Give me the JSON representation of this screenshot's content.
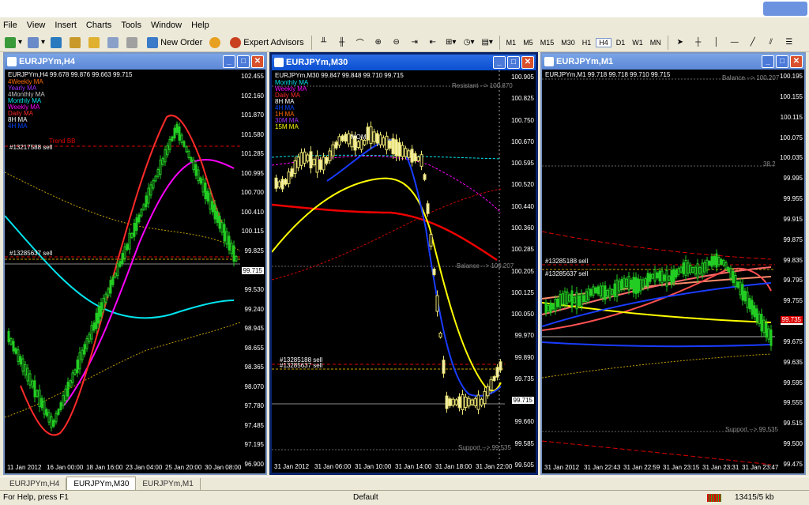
{
  "menu": [
    "File",
    "View",
    "Insert",
    "Charts",
    "Tools",
    "Window",
    "Help"
  ],
  "toolbar": {
    "new_order": "New Order",
    "expert_advisors": "Expert Advisors",
    "timeframes": [
      "M1",
      "M5",
      "M15",
      "M30",
      "H1",
      "H4",
      "D1",
      "W1",
      "MN"
    ],
    "active_timeframe": "H4"
  },
  "panels": [
    {
      "title": "EURJPYm,H4",
      "header": "EURJPYm,H4  99.678 99.876 99.663 99.715",
      "legend": [
        {
          "text": "4Weekly MA",
          "color": "#ff6a00"
        },
        {
          "text": "Yearly MA",
          "color": "#9b30ff"
        },
        {
          "text": "4Monthly MA",
          "color": "#c8c8c8"
        },
        {
          "text": "Monthly MA",
          "color": "#00e5ee"
        },
        {
          "text": "Weekly MA",
          "color": "#ff00ff"
        },
        {
          "text": "Daily MA",
          "color": "#ff2a2a"
        },
        {
          "text": "8H MA",
          "color": "#ffffff"
        },
        {
          "text": "4H MA",
          "color": "#0044ff"
        }
      ],
      "labels": [
        "#13217588 sell",
        "#13285637 sell",
        "Trend BB"
      ],
      "prices": [
        "102.455",
        "102.160",
        "101.870",
        "101.580",
        "101.285",
        "100.995",
        "100.700",
        "100.410",
        "100.115",
        "99.825",
        "99.715",
        "99.530",
        "99.240",
        "98.945",
        "98.655",
        "98.365",
        "98.070",
        "97.780",
        "97.485",
        "97.195",
        "96.900"
      ],
      "current": "99.715",
      "dates": [
        "11 Jan 2012",
        "16 Jan 00:00",
        "18 Jan 16:00",
        "23 Jan 04:00",
        "25 Jan 20:00",
        "30 Jan 08:00"
      ]
    },
    {
      "title": "EURJPYm,M30",
      "header": "EURJPYm,M30  99.847 99.848 99.710 99.715",
      "legend": [
        {
          "text": "Monthly MA",
          "color": "#00e5ee"
        },
        {
          "text": "Weekly MA",
          "color": "#ff00ff"
        },
        {
          "text": "Daily MA",
          "color": "#ff2a2a"
        },
        {
          "text": "8H MA",
          "color": "#ffffff"
        },
        {
          "text": "4H MA",
          "color": "#0044ff"
        },
        {
          "text": "1H MA",
          "color": "#ff6a00"
        },
        {
          "text": "30M MA",
          "color": "#9b30ff"
        },
        {
          "text": "15M MA",
          "color": "#ffff00"
        }
      ],
      "labels": [
        "Resistant --> 100.870",
        "MOM",
        "Balance --> 100.207",
        "#13285188 sell",
        "#13285637 sell",
        "Support --> 99.535"
      ],
      "prices": [
        "100.905",
        "100.825",
        "100.750",
        "100.670",
        "100.595",
        "100.520",
        "100.440",
        "100.360",
        "100.285",
        "100.205",
        "100.125",
        "100.050",
        "99.970",
        "99.890",
        "99.735",
        "99.715",
        "99.660",
        "99.585",
        "99.505"
      ],
      "current": "99.715",
      "dates": [
        "31 Jan 2012",
        "31 Jan 06:00",
        "31 Jan 10:00",
        "31 Jan 14:00",
        "31 Jan 18:00",
        "31 Jan 22:00"
      ]
    },
    {
      "title": "EURJPYm,M1",
      "header": "EURJPYm,M1  99.718 99.718 99.710 99.715",
      "labels": [
        "Balance --> 100.207",
        "38.2",
        "#13285188 sell",
        "#13285637 sell",
        "Support --> 99.535"
      ],
      "prices": [
        "100.195",
        "100.155",
        "100.115",
        "100.075",
        "100.035",
        "99.995",
        "99.955",
        "99.915",
        "99.875",
        "99.835",
        "99.795",
        "99.755",
        "99.715",
        "99.675",
        "99.635",
        "99.595",
        "99.555",
        "99.515",
        "99.500",
        "99.475"
      ],
      "current": "99.715",
      "red_price": "99.735",
      "dates": [
        "31 Jan 2012",
        "31 Jan 22:43",
        "31 Jan 22:59",
        "31 Jan 23:15",
        "31 Jan 23:31",
        "31 Jan 23:47"
      ]
    }
  ],
  "tabs": [
    "EURJPYm,H4",
    "EURJPYm,M30",
    "EURJPYm,M1"
  ],
  "active_tab": "EURJPYm,M30",
  "status": {
    "help": "For Help, press F1",
    "profile": "Default",
    "traffic": "13415/5 kb"
  }
}
